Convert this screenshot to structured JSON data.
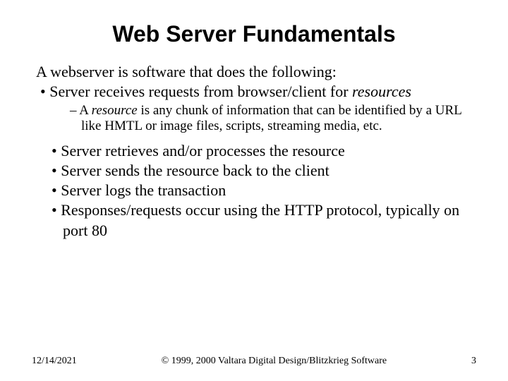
{
  "title": "Web Server Fundamentals",
  "intro": "A webserver is software that does the following:",
  "bullet_a_pre": "Server receives requests from browser/client for ",
  "bullet_a_em": "resources",
  "dash_pre": "– A ",
  "dash_em": "resource",
  "dash_post": " is any chunk of information that can be identified by a URL like HMTL or image files, scripts, streaming media, etc.",
  "bullets": {
    "b1": "Server retrieves and/or processes the resource",
    "b2": "Server sends the resource back to the client",
    "b3": "Server logs the transaction",
    "b4": "Responses/requests occur using the HTTP protocol, typically on port 80"
  },
  "footer": {
    "date": "12/14/2021",
    "copyright": "© 1999, 2000 Valtara Digital Design/Blitzkrieg Software",
    "page": "3"
  }
}
